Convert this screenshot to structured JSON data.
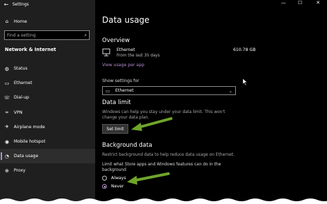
{
  "window": {
    "title": "Settings",
    "minimize": "—",
    "maximize": "☐",
    "close": "✕"
  },
  "sidebar": {
    "home_label": "Home",
    "search_placeholder": "Find a setting",
    "section_title": "Network & Internet",
    "items": [
      {
        "label": "Status",
        "icon": "globe-icon",
        "glyph": "◍"
      },
      {
        "label": "Ethernet",
        "icon": "ethernet-icon",
        "glyph": "▭"
      },
      {
        "label": "Dial-up",
        "icon": "dial-up-icon",
        "glyph": "☏"
      },
      {
        "label": "VPN",
        "icon": "vpn-icon",
        "glyph": "∞"
      },
      {
        "label": "Airplane mode",
        "icon": "airplane-icon",
        "glyph": "✈"
      },
      {
        "label": "Mobile hotspot",
        "icon": "hotspot-icon",
        "glyph": "◉"
      },
      {
        "label": "Data usage",
        "icon": "data-usage-icon",
        "glyph": "◔",
        "selected": true
      },
      {
        "label": "Proxy",
        "icon": "proxy-icon",
        "glyph": "⊕"
      }
    ]
  },
  "main": {
    "page_title": "Data usage",
    "overview": {
      "heading": "Overview",
      "connection_name": "Ethernet",
      "connection_sub": "From the last 30 days",
      "usage": "610.78 GB",
      "link": "View usage per app"
    },
    "show_settings_label": "Show settings for",
    "dropdown_value": "Ethernet",
    "data_limit": {
      "heading": "Data limit",
      "desc_line1": "Windows can help you stay under your data limit. This won't",
      "desc_line2": "change your data plan.",
      "button": "Set limit"
    },
    "background_data": {
      "heading": "Background data",
      "desc": "Restrict background data to help reduce data usage on Ethernet.",
      "question_line1": "Limit what Store apps and Windows features can do in the",
      "question_line2": "background",
      "options": [
        {
          "label": "Always",
          "selected": false
        },
        {
          "label": "Never",
          "selected": true
        }
      ]
    }
  },
  "colors": {
    "accent": "#b48fd0",
    "arrow": "#6fa52a"
  }
}
